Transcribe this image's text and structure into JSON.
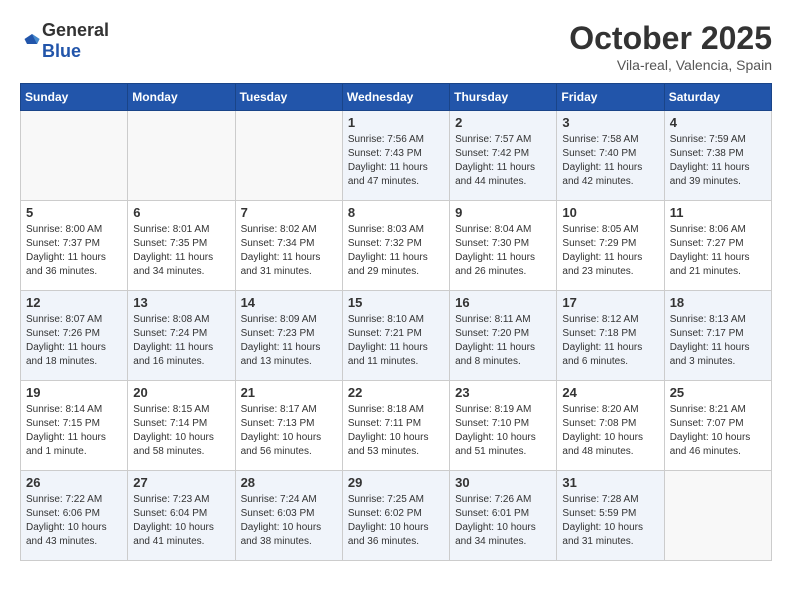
{
  "header": {
    "logo_general": "General",
    "logo_blue": "Blue",
    "month_year": "October 2025",
    "location": "Vila-real, Valencia, Spain"
  },
  "days_of_week": [
    "Sunday",
    "Monday",
    "Tuesday",
    "Wednesday",
    "Thursday",
    "Friday",
    "Saturday"
  ],
  "weeks": [
    [
      {
        "day": "",
        "sunrise": "",
        "sunset": "",
        "daylight": ""
      },
      {
        "day": "",
        "sunrise": "",
        "sunset": "",
        "daylight": ""
      },
      {
        "day": "",
        "sunrise": "",
        "sunset": "",
        "daylight": ""
      },
      {
        "day": "1",
        "sunrise": "Sunrise: 7:56 AM",
        "sunset": "Sunset: 7:43 PM",
        "daylight": "Daylight: 11 hours and 47 minutes."
      },
      {
        "day": "2",
        "sunrise": "Sunrise: 7:57 AM",
        "sunset": "Sunset: 7:42 PM",
        "daylight": "Daylight: 11 hours and 44 minutes."
      },
      {
        "day": "3",
        "sunrise": "Sunrise: 7:58 AM",
        "sunset": "Sunset: 7:40 PM",
        "daylight": "Daylight: 11 hours and 42 minutes."
      },
      {
        "day": "4",
        "sunrise": "Sunrise: 7:59 AM",
        "sunset": "Sunset: 7:38 PM",
        "daylight": "Daylight: 11 hours and 39 minutes."
      }
    ],
    [
      {
        "day": "5",
        "sunrise": "Sunrise: 8:00 AM",
        "sunset": "Sunset: 7:37 PM",
        "daylight": "Daylight: 11 hours and 36 minutes."
      },
      {
        "day": "6",
        "sunrise": "Sunrise: 8:01 AM",
        "sunset": "Sunset: 7:35 PM",
        "daylight": "Daylight: 11 hours and 34 minutes."
      },
      {
        "day": "7",
        "sunrise": "Sunrise: 8:02 AM",
        "sunset": "Sunset: 7:34 PM",
        "daylight": "Daylight: 11 hours and 31 minutes."
      },
      {
        "day": "8",
        "sunrise": "Sunrise: 8:03 AM",
        "sunset": "Sunset: 7:32 PM",
        "daylight": "Daylight: 11 hours and 29 minutes."
      },
      {
        "day": "9",
        "sunrise": "Sunrise: 8:04 AM",
        "sunset": "Sunset: 7:30 PM",
        "daylight": "Daylight: 11 hours and 26 minutes."
      },
      {
        "day": "10",
        "sunrise": "Sunrise: 8:05 AM",
        "sunset": "Sunset: 7:29 PM",
        "daylight": "Daylight: 11 hours and 23 minutes."
      },
      {
        "day": "11",
        "sunrise": "Sunrise: 8:06 AM",
        "sunset": "Sunset: 7:27 PM",
        "daylight": "Daylight: 11 hours and 21 minutes."
      }
    ],
    [
      {
        "day": "12",
        "sunrise": "Sunrise: 8:07 AM",
        "sunset": "Sunset: 7:26 PM",
        "daylight": "Daylight: 11 hours and 18 minutes."
      },
      {
        "day": "13",
        "sunrise": "Sunrise: 8:08 AM",
        "sunset": "Sunset: 7:24 PM",
        "daylight": "Daylight: 11 hours and 16 minutes."
      },
      {
        "day": "14",
        "sunrise": "Sunrise: 8:09 AM",
        "sunset": "Sunset: 7:23 PM",
        "daylight": "Daylight: 11 hours and 13 minutes."
      },
      {
        "day": "15",
        "sunrise": "Sunrise: 8:10 AM",
        "sunset": "Sunset: 7:21 PM",
        "daylight": "Daylight: 11 hours and 11 minutes."
      },
      {
        "day": "16",
        "sunrise": "Sunrise: 8:11 AM",
        "sunset": "Sunset: 7:20 PM",
        "daylight": "Daylight: 11 hours and 8 minutes."
      },
      {
        "day": "17",
        "sunrise": "Sunrise: 8:12 AM",
        "sunset": "Sunset: 7:18 PM",
        "daylight": "Daylight: 11 hours and 6 minutes."
      },
      {
        "day": "18",
        "sunrise": "Sunrise: 8:13 AM",
        "sunset": "Sunset: 7:17 PM",
        "daylight": "Daylight: 11 hours and 3 minutes."
      }
    ],
    [
      {
        "day": "19",
        "sunrise": "Sunrise: 8:14 AM",
        "sunset": "Sunset: 7:15 PM",
        "daylight": "Daylight: 11 hours and 1 minute."
      },
      {
        "day": "20",
        "sunrise": "Sunrise: 8:15 AM",
        "sunset": "Sunset: 7:14 PM",
        "daylight": "Daylight: 10 hours and 58 minutes."
      },
      {
        "day": "21",
        "sunrise": "Sunrise: 8:17 AM",
        "sunset": "Sunset: 7:13 PM",
        "daylight": "Daylight: 10 hours and 56 minutes."
      },
      {
        "day": "22",
        "sunrise": "Sunrise: 8:18 AM",
        "sunset": "Sunset: 7:11 PM",
        "daylight": "Daylight: 10 hours and 53 minutes."
      },
      {
        "day": "23",
        "sunrise": "Sunrise: 8:19 AM",
        "sunset": "Sunset: 7:10 PM",
        "daylight": "Daylight: 10 hours and 51 minutes."
      },
      {
        "day": "24",
        "sunrise": "Sunrise: 8:20 AM",
        "sunset": "Sunset: 7:08 PM",
        "daylight": "Daylight: 10 hours and 48 minutes."
      },
      {
        "day": "25",
        "sunrise": "Sunrise: 8:21 AM",
        "sunset": "Sunset: 7:07 PM",
        "daylight": "Daylight: 10 hours and 46 minutes."
      }
    ],
    [
      {
        "day": "26",
        "sunrise": "Sunrise: 7:22 AM",
        "sunset": "Sunset: 6:06 PM",
        "daylight": "Daylight: 10 hours and 43 minutes."
      },
      {
        "day": "27",
        "sunrise": "Sunrise: 7:23 AM",
        "sunset": "Sunset: 6:04 PM",
        "daylight": "Daylight: 10 hours and 41 minutes."
      },
      {
        "day": "28",
        "sunrise": "Sunrise: 7:24 AM",
        "sunset": "Sunset: 6:03 PM",
        "daylight": "Daylight: 10 hours and 38 minutes."
      },
      {
        "day": "29",
        "sunrise": "Sunrise: 7:25 AM",
        "sunset": "Sunset: 6:02 PM",
        "daylight": "Daylight: 10 hours and 36 minutes."
      },
      {
        "day": "30",
        "sunrise": "Sunrise: 7:26 AM",
        "sunset": "Sunset: 6:01 PM",
        "daylight": "Daylight: 10 hours and 34 minutes."
      },
      {
        "day": "31",
        "sunrise": "Sunrise: 7:28 AM",
        "sunset": "Sunset: 5:59 PM",
        "daylight": "Daylight: 10 hours and 31 minutes."
      },
      {
        "day": "",
        "sunrise": "",
        "sunset": "",
        "daylight": ""
      }
    ]
  ]
}
